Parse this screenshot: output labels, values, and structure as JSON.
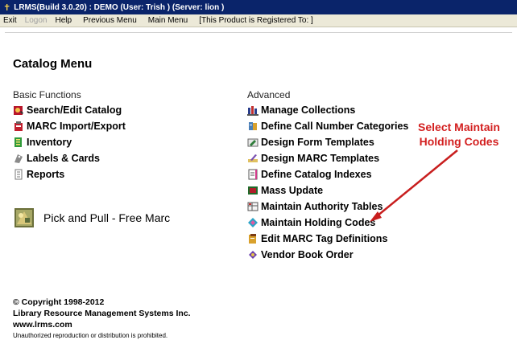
{
  "window": {
    "title": "LRMS(Build 3.0.20) : DEMO (User: Trish ) (Server: lion )"
  },
  "menubar": {
    "items": [
      "Exit",
      "Logon",
      "Help",
      "Previous Menu",
      "Main Menu",
      "[This Product is Registered To: ]"
    ],
    "disabled": [
      "Logon"
    ]
  },
  "page": {
    "title": "Catalog Menu"
  },
  "basic": {
    "label": "Basic Functions",
    "items": [
      {
        "label": "Search/Edit Catalog",
        "icon": "search-catalog-icon"
      },
      {
        "label": "MARC Import/Export",
        "icon": "marc-import-icon"
      },
      {
        "label": "Inventory",
        "icon": "inventory-icon"
      },
      {
        "label": "Labels & Cards",
        "icon": "labels-icon"
      },
      {
        "label": "Reports",
        "icon": "reports-icon"
      }
    ]
  },
  "advanced": {
    "label": "Advanced",
    "items": [
      {
        "label": "Manage Collections",
        "icon": "collections-icon"
      },
      {
        "label": "Define Call Number Categories",
        "icon": "call-number-icon"
      },
      {
        "label": "Design Form Templates",
        "icon": "form-templates-icon"
      },
      {
        "label": "Design MARC Templates",
        "icon": "marc-templates-icon"
      },
      {
        "label": "Define Catalog Indexes",
        "icon": "catalog-indexes-icon"
      },
      {
        "label": "Mass Update",
        "icon": "mass-update-icon"
      },
      {
        "label": "Maintain Authority Tables",
        "icon": "authority-tables-icon"
      },
      {
        "label": "Maintain Holding Codes",
        "icon": "holding-codes-icon"
      },
      {
        "label": "Edit MARC Tag Definitions",
        "icon": "marc-tag-icon"
      },
      {
        "label": "Vendor Book Order",
        "icon": "vendor-order-icon"
      }
    ]
  },
  "pick_pull": {
    "label": "Pick and Pull - Free Marc",
    "icon": "pick-pull-icon"
  },
  "annotation": {
    "line1": "Select Maintain",
    "line2": "Holding Codes",
    "color": "#d32020"
  },
  "footer": {
    "copyright": "© Copyright 1998-2012",
    "company": "Library Resource Management Systems Inc.",
    "url": "www.lrms.com",
    "notice": "Unauthorized reproduction or distribution is prohibited."
  },
  "colors": {
    "titlebar": "#0a246a",
    "menubar": "#ece9d8",
    "annotation": "#d32020"
  }
}
